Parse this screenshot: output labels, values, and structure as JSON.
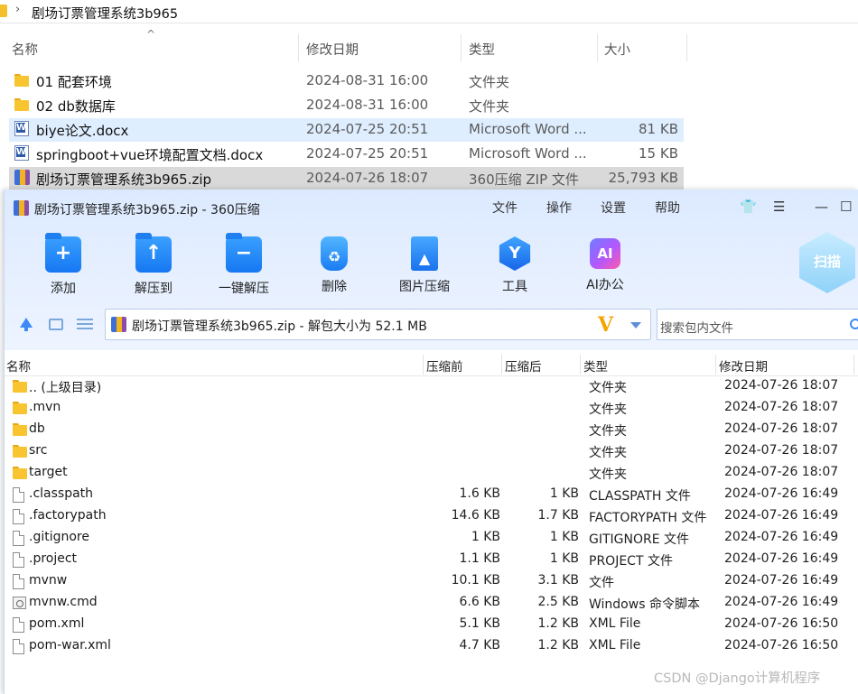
{
  "explorer": {
    "breadcrumb": "剧场订票管理系统3b965",
    "columns": {
      "name": "名称",
      "date": "修改日期",
      "type": "类型",
      "size": "大小"
    },
    "rows": [
      {
        "name": "01 配套环境",
        "date": "2024-08-31 16:00",
        "type": "文件夹",
        "size": "",
        "icon": "folder-icon"
      },
      {
        "name": "02 db数据库",
        "date": "2024-08-31 16:00",
        "type": "文件夹",
        "size": "",
        "icon": "folder-icon"
      },
      {
        "name": "biye论文.docx",
        "date": "2024-07-25 20:51",
        "type": "Microsoft Word ...",
        "size": "81 KB",
        "icon": "word-doc-icon"
      },
      {
        "name": "springboot+vue环境配置文档.docx",
        "date": "2024-07-25 20:51",
        "type": "Microsoft Word ...",
        "size": "15 KB",
        "icon": "word-doc-icon"
      },
      {
        "name": "剧场订票管理系统3b965.zip",
        "date": "2024-07-26 18:07",
        "type": "360压缩 ZIP 文件",
        "size": "25,793 KB",
        "icon": "zip-archive-icon"
      }
    ]
  },
  "zipwin": {
    "title": "剧场订票管理系统3b965.zip - 360压缩",
    "menu": [
      "文件",
      "操作",
      "设置",
      "帮助"
    ],
    "toolbar": [
      "添加",
      "解压到",
      "一键解压",
      "删除",
      "图片压缩",
      "工具",
      "AI办公"
    ],
    "scan_label": "扫描",
    "address": "剧场订票管理系统3b965.zip - 解包大小为 52.1 MB",
    "search_placeholder": "搜索包内文件",
    "columns": {
      "name": "名称",
      "before": "压缩前",
      "after": "压缩后",
      "type": "类型",
      "date": "修改日期"
    },
    "rows": [
      {
        "name": ".. (上级目录)",
        "before": "",
        "after": "",
        "type": "文件夹",
        "date": "2024-07-26 18:07",
        "icon": "folder"
      },
      {
        "name": ".mvn",
        "before": "",
        "after": "",
        "type": "文件夹",
        "date": "2024-07-26 18:07",
        "icon": "folder"
      },
      {
        "name": "db",
        "before": "",
        "after": "",
        "type": "文件夹",
        "date": "2024-07-26 18:07",
        "icon": "folder"
      },
      {
        "name": "src",
        "before": "",
        "after": "",
        "type": "文件夹",
        "date": "2024-07-26 18:07",
        "icon": "folder"
      },
      {
        "name": "target",
        "before": "",
        "after": "",
        "type": "文件夹",
        "date": "2024-07-26 18:07",
        "icon": "folder"
      },
      {
        "name": ".classpath",
        "before": "1.6 KB",
        "after": "1 KB",
        "type": "CLASSPATH 文件",
        "date": "2024-07-26 16:49",
        "icon": "file"
      },
      {
        "name": ".factorypath",
        "before": "14.6 KB",
        "after": "1.7 KB",
        "type": "FACTORYPATH 文件",
        "date": "2024-07-26 16:49",
        "icon": "file"
      },
      {
        "name": ".gitignore",
        "before": "1 KB",
        "after": "1 KB",
        "type": "GITIGNORE 文件",
        "date": "2024-07-26 16:49",
        "icon": "file"
      },
      {
        "name": ".project",
        "before": "1.1 KB",
        "after": "1 KB",
        "type": "PROJECT 文件",
        "date": "2024-07-26 16:49",
        "icon": "file"
      },
      {
        "name": "mvnw",
        "before": "10.1 KB",
        "after": "3.1 KB",
        "type": "文件",
        "date": "2024-07-26 16:49",
        "icon": "file"
      },
      {
        "name": "mvnw.cmd",
        "before": "6.6 KB",
        "after": "2.5 KB",
        "type": "Windows 命令脚本",
        "date": "2024-07-26 16:49",
        "icon": "cmd"
      },
      {
        "name": "pom.xml",
        "before": "5.1 KB",
        "after": "1.2 KB",
        "type": "XML File",
        "date": "2024-07-26 16:50",
        "icon": "file"
      },
      {
        "name": "pom-war.xml",
        "before": "4.7 KB",
        "after": "1.2 KB",
        "type": "XML File",
        "date": "2024-07-26 16:50",
        "icon": "file"
      }
    ]
  },
  "watermark": "CSDN @Django计算机程序"
}
